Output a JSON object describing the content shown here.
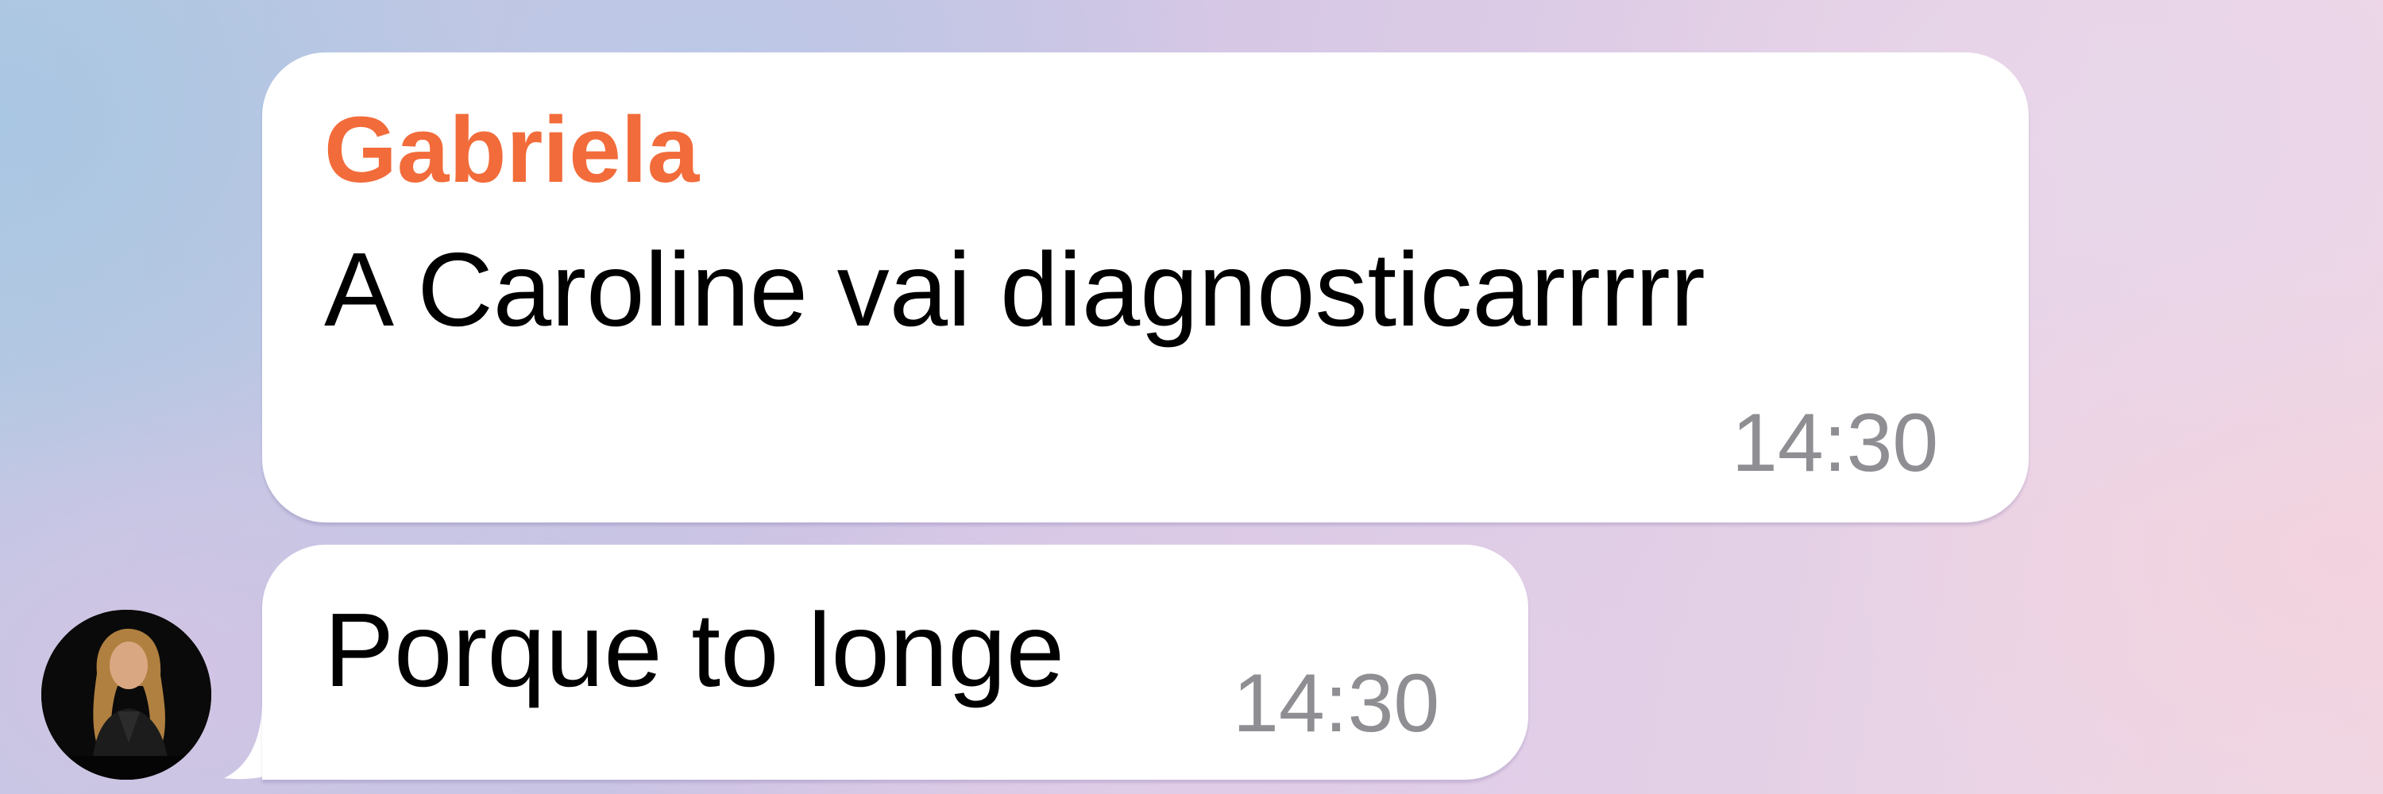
{
  "theme": {
    "sender_color": "#f26b3a",
    "text_color": "#000000",
    "time_color": "#8e8e93",
    "bubble_color": "#ffffff"
  },
  "messages": [
    {
      "sender": "Gabriela",
      "text": "A Caroline vai diagnosticarrrrr",
      "time": "14:30"
    },
    {
      "text": "Porque to longe",
      "time": "14:30",
      "avatar_icon": "user-avatar"
    }
  ]
}
